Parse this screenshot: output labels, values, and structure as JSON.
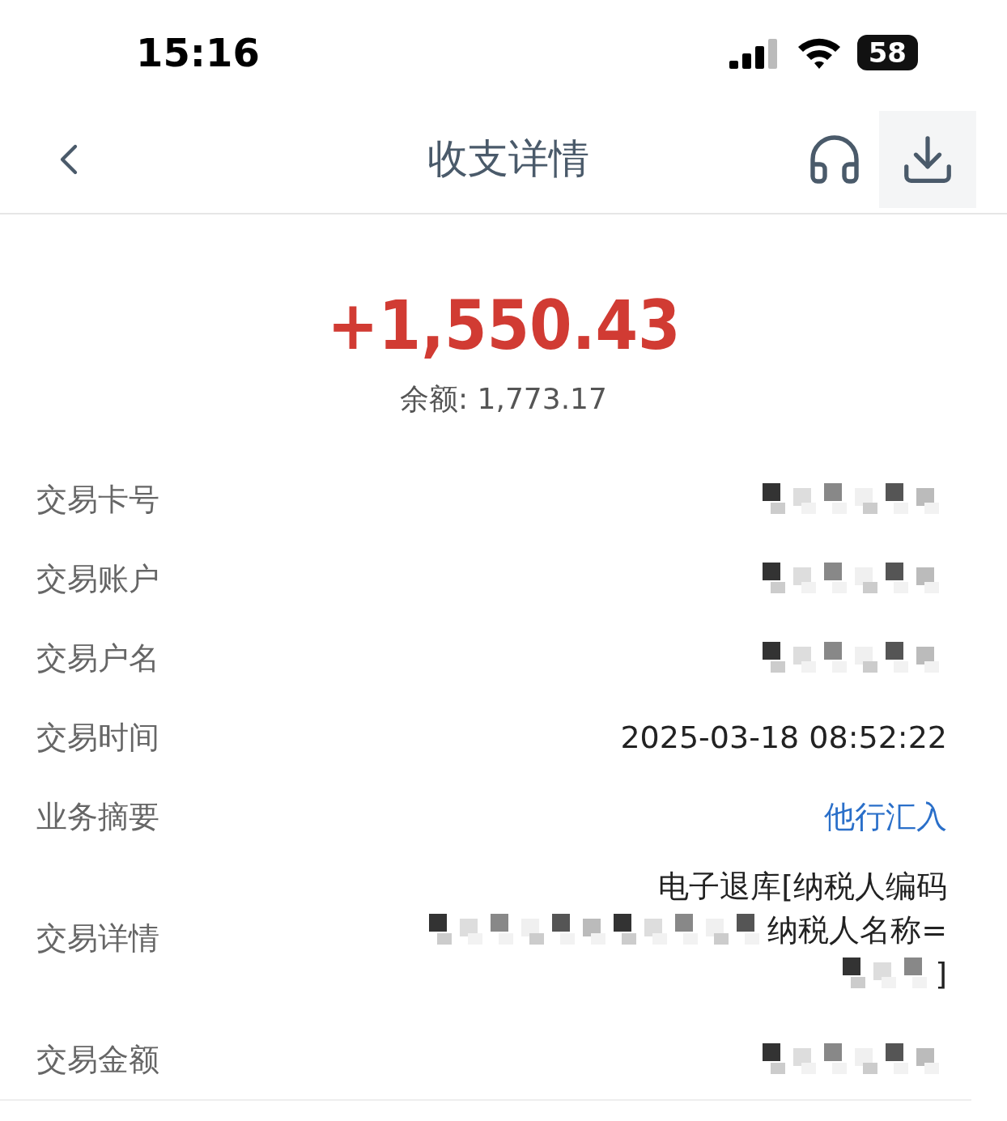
{
  "status_bar": {
    "time": "15:16",
    "battery": "58"
  },
  "nav": {
    "title": "收支详情"
  },
  "summary": {
    "amount": "+1,550.43",
    "balance": "余额: 1,773.17"
  },
  "rows": [
    {
      "label": "交易卡号",
      "kind": "masked"
    },
    {
      "label": "交易账户",
      "kind": "masked"
    },
    {
      "label": "交易户名",
      "kind": "masked"
    },
    {
      "label": "交易时间",
      "kind": "text",
      "value": "2025-03-18 08:52:22"
    },
    {
      "label": "业务摘要",
      "kind": "link",
      "value": "他行汇入"
    },
    {
      "label": "交易详情",
      "kind": "multiline",
      "lines": [
        {
          "text": "电子退库[纳税人编码",
          "masked": false
        },
        {
          "text": "纳税人名称=",
          "masked": true
        },
        {
          "text": "]",
          "masked": true
        }
      ]
    },
    {
      "label": "交易金额",
      "kind": "masked"
    }
  ]
}
